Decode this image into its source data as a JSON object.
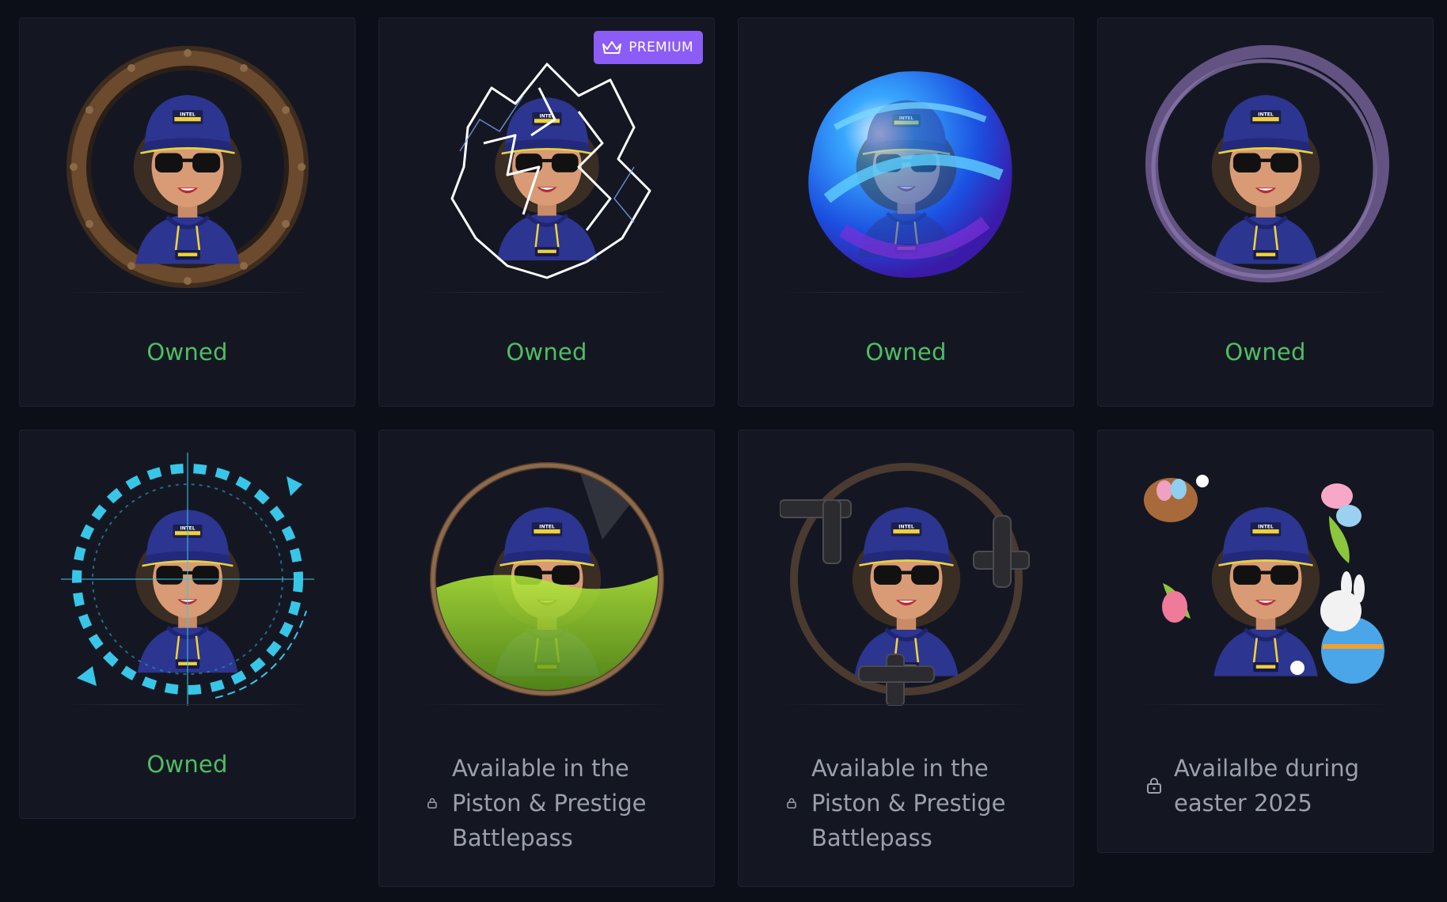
{
  "items": [
    {
      "name": "rusted-porthole-frame",
      "status": "Owned"
    },
    {
      "name": "lightning-frame",
      "badge": "PREMIUM",
      "status": "Owned"
    },
    {
      "name": "blue-energy-frame",
      "status": "Owned"
    },
    {
      "name": "purple-smoke-frame",
      "status": "Owned"
    },
    {
      "name": "hud-target-frame",
      "status": "Owned"
    },
    {
      "name": "green-liquid-frame",
      "status": "Available in the Piston & Prestige Battlepass"
    },
    {
      "name": "pipe-frame",
      "status": "Available in the Piston & Prestige Battlepass"
    },
    {
      "name": "easter-frame",
      "status": "Availalbe during easter 2025"
    }
  ],
  "avatar_text": {
    "cap": "INTEL",
    "band": "AFRICA",
    "sub": "MASTERS"
  },
  "colors": {
    "owned": "#4fbe63",
    "locked": "#9aa0ad",
    "premium": "#8b5cf6",
    "card": "#141722",
    "background": "#0d0f18"
  }
}
